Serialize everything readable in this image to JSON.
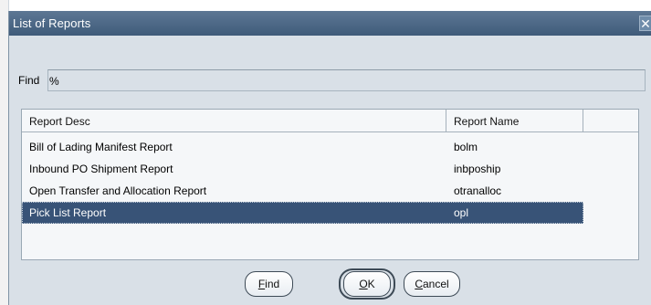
{
  "dialog": {
    "title": "List of Reports",
    "close_glyph": "✕"
  },
  "find": {
    "label": "Find",
    "value": "%"
  },
  "table": {
    "columns": [
      "Report Desc",
      "Report Name",
      ""
    ],
    "rows": [
      {
        "desc": "Bill of Lading Manifest Report",
        "name": "bolm",
        "selected": false
      },
      {
        "desc": "Inbound PO Shipment Report",
        "name": "inbpoship",
        "selected": false
      },
      {
        "desc": "Open Transfer and Allocation Report",
        "name": "otranalloc",
        "selected": false
      },
      {
        "desc": "Pick List Report",
        "name": "opl",
        "selected": true
      }
    ]
  },
  "buttons": {
    "find_first": "F",
    "find_rest": "ind",
    "ok_first": "O",
    "ok_rest": "K",
    "cancel_first": "C",
    "cancel_rest": "ancel"
  },
  "colors": {
    "titlebar": "#4a6685",
    "dialog_bg": "#d9e0e7",
    "selected_row": "#385377"
  }
}
